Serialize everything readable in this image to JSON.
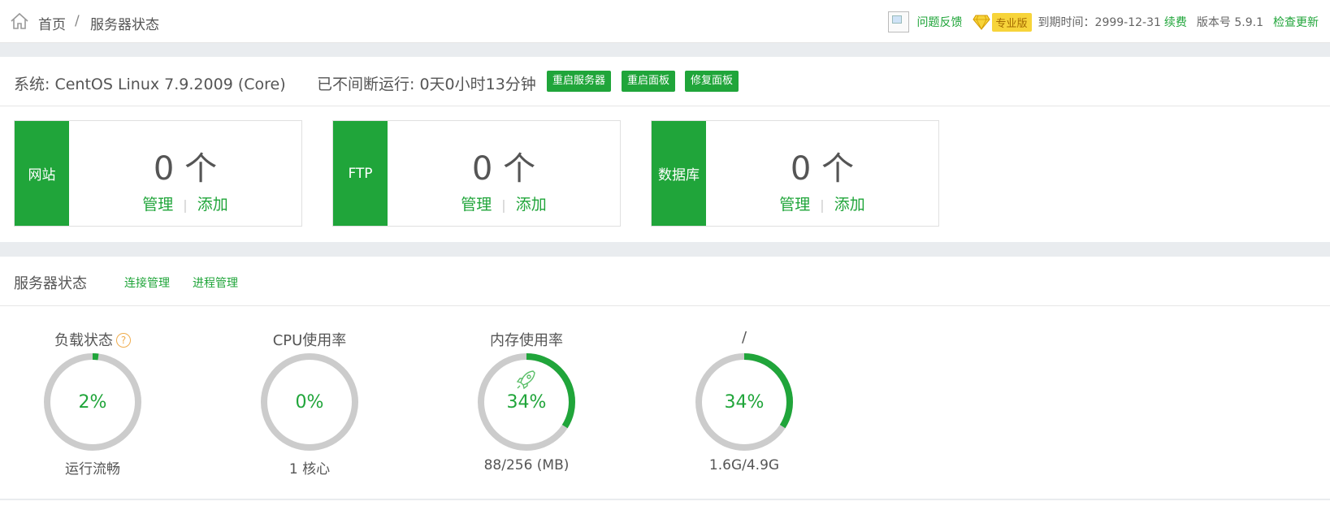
{
  "breadcrumb": {
    "home": "首页",
    "separator": "/",
    "current": "服务器状态"
  },
  "topbar": {
    "feedback": "问题反馈",
    "pro_badge": "专业版",
    "expire_label": "到期时间：2999-12-31",
    "renew": "续费",
    "version": "版本号 5.9.1",
    "check_update": "检查更新"
  },
  "system": {
    "os": "系统: CentOS Linux 7.9.2009 (Core)",
    "uptime": "已不间断运行: 0天0小时13分钟",
    "buttons": {
      "restart_server": "重启服务器",
      "restart_panel": "重启面板",
      "repair_panel": "修复面板"
    }
  },
  "cards": [
    {
      "name": "网站",
      "count": "0 个",
      "manage": "管理",
      "add": "添加"
    },
    {
      "name": "FTP",
      "count": "0 个",
      "manage": "管理",
      "add": "添加"
    },
    {
      "name": "数据库",
      "count": "0 个",
      "manage": "管理",
      "add": "添加"
    }
  ],
  "status": {
    "title": "服务器状态",
    "conn_manage": "连接管理",
    "proc_manage": "进程管理",
    "gauges": [
      {
        "label": "负载状态",
        "value": "2%",
        "percent": 2,
        "sub": "运行流畅"
      },
      {
        "label": "CPU使用率",
        "value": "0%",
        "percent": 0,
        "sub": "1 核心"
      },
      {
        "label": "内存使用率",
        "value": "34%",
        "percent": 34,
        "sub": "88/256 (MB)"
      },
      {
        "label": "/",
        "value": "34%",
        "percent": 34,
        "sub": "1.6G/4.9G"
      }
    ]
  },
  "colors": {
    "accent": "#20a53a",
    "ring_track": "#cccccc",
    "band": "#e9ecef"
  }
}
